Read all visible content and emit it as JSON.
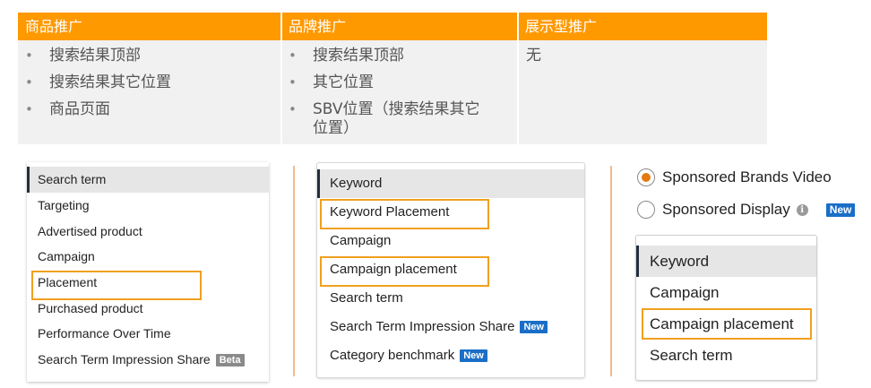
{
  "ad_types_table": {
    "headers": [
      "商品推广",
      "品牌推广",
      "展示型推广"
    ],
    "sponsored_products": [
      "搜索结果顶部",
      "搜索结果其它位置",
      "商品页面"
    ],
    "sponsored_brands": [
      "搜索结果顶部",
      "其它位置",
      "SBV位置（搜索结果其它\n位置）"
    ],
    "sponsored_display": "无"
  },
  "panel_sponsored_products": {
    "items": [
      "Search term",
      "Targeting",
      "Advertised product",
      "Campaign",
      "Placement",
      "Purchased product",
      "Performance Over Time",
      "Search Term Impression Share"
    ],
    "selected": "Search term",
    "beta_badge": "Beta"
  },
  "panel_sponsored_brands": {
    "items": [
      "Keyword",
      "Keyword Placement",
      "Campaign",
      "Campaign placement",
      "Search term",
      "Search Term Impression Share",
      "Category benchmark"
    ],
    "selected": "Keyword",
    "new_badge": "New"
  },
  "campaign_type_radios": {
    "options": [
      "Sponsored Brands Video",
      "Sponsored Display"
    ],
    "selected": "Sponsored Brands Video",
    "new_badge": "New",
    "info_icon": "info-icon"
  },
  "panel_sbv": {
    "items": [
      "Keyword",
      "Campaign",
      "Campaign placement",
      "Search term"
    ],
    "selected": "Keyword"
  },
  "colors": {
    "accent_orange": "#ff9900",
    "highlight_border": "#f0a020",
    "new_badge": "#1a6ec7",
    "beta_badge": "#8a8a8a",
    "radio_selected": "#e47911",
    "selected_row_bg": "#e6e6e6"
  }
}
